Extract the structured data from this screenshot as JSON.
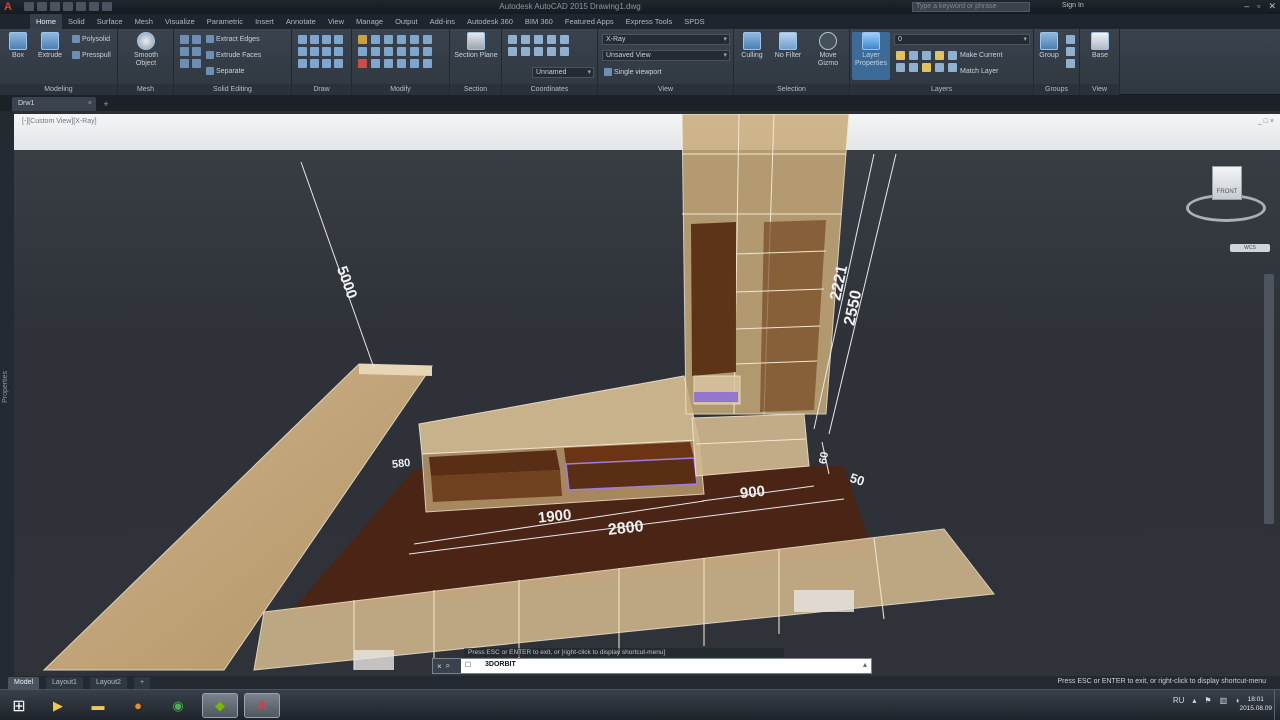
{
  "title_bar": {
    "doc_title": "Autodesk AutoCAD 2015  Drawing1.dwg",
    "search_placeholder": "Type a keyword or phrase",
    "sign_in": "Sign In"
  },
  "ribbon_tabs": [
    "Home",
    "Solid",
    "Surface",
    "Mesh",
    "Visualize",
    "Parametric",
    "Insert",
    "Annotate",
    "View",
    "Manage",
    "Output",
    "Add-ins",
    "Autodesk 360",
    "BIM 360",
    "Featured Apps",
    "Express Tools",
    "SPDS"
  ],
  "ribbon": {
    "modeling": {
      "label": "Modeling",
      "box": "Box",
      "extrude": "Extrude",
      "polysolid": "Polysolid",
      "presspull": "Presspull"
    },
    "mesh": {
      "label": "Mesh",
      "smooth_object": "Smooth Object"
    },
    "solid_editing": {
      "label": "Solid Editing",
      "extract_edges": "Extract Edges",
      "extrude_faces": "Extrude Faces",
      "separate": "Separate"
    },
    "draw": {
      "label": "Draw"
    },
    "modify": {
      "label": "Modify"
    },
    "section": {
      "label": "Section",
      "section_plane": "Section Plane"
    },
    "coordinates": {
      "label": "Coordinates",
      "ucs_combo": "Unnamed"
    },
    "view": {
      "label": "View",
      "visual_style": "X-Ray",
      "saved_view": "Unsaved View",
      "viewport": "Single viewport"
    },
    "selection": {
      "label": "Selection",
      "culling": "Culling",
      "no_filter": "No Filter",
      "move_gizmo": "Move Gizmo"
    },
    "layers": {
      "label": "Layers",
      "layer_properties": "Layer Properties",
      "layer_combo": "0",
      "make_current": "Make Current",
      "match_layer": "Match Layer"
    },
    "groups": {
      "label": "Groups",
      "group": "Group"
    },
    "view2": {
      "label": "View",
      "base": "Base"
    }
  },
  "file_tab": {
    "name": "Drw1"
  },
  "viewport": {
    "label": "[-][Custom View][X-Ray]",
    "controls": "_ □ ×",
    "viewcube_face": "FRONT",
    "wcs": "WCS",
    "dimensions": [
      "5000",
      "2221",
      "2550",
      "1900",
      "900",
      "2800",
      "50",
      "60",
      "580"
    ]
  },
  "side_panel": {
    "label": "Properties"
  },
  "command": {
    "history": "Press ESC or ENTER to exit, or [right-click to display shortcut-menu]",
    "prompt": "☐",
    "value": "3DORBIT"
  },
  "layout_tabs": [
    "Model",
    "Layout1",
    "Layout2",
    "+"
  ],
  "status_message": "Press ESC or ENTER to exit, or right-click to display shortcut-menu",
  "taskbar": {
    "lang": "RU",
    "time": "18:01",
    "date": "2015.08.09"
  },
  "colors": {
    "wood": "#c9a97a",
    "floor": "#4a2414",
    "accent": "#3d6b98",
    "purple": "#8a6bd6"
  }
}
